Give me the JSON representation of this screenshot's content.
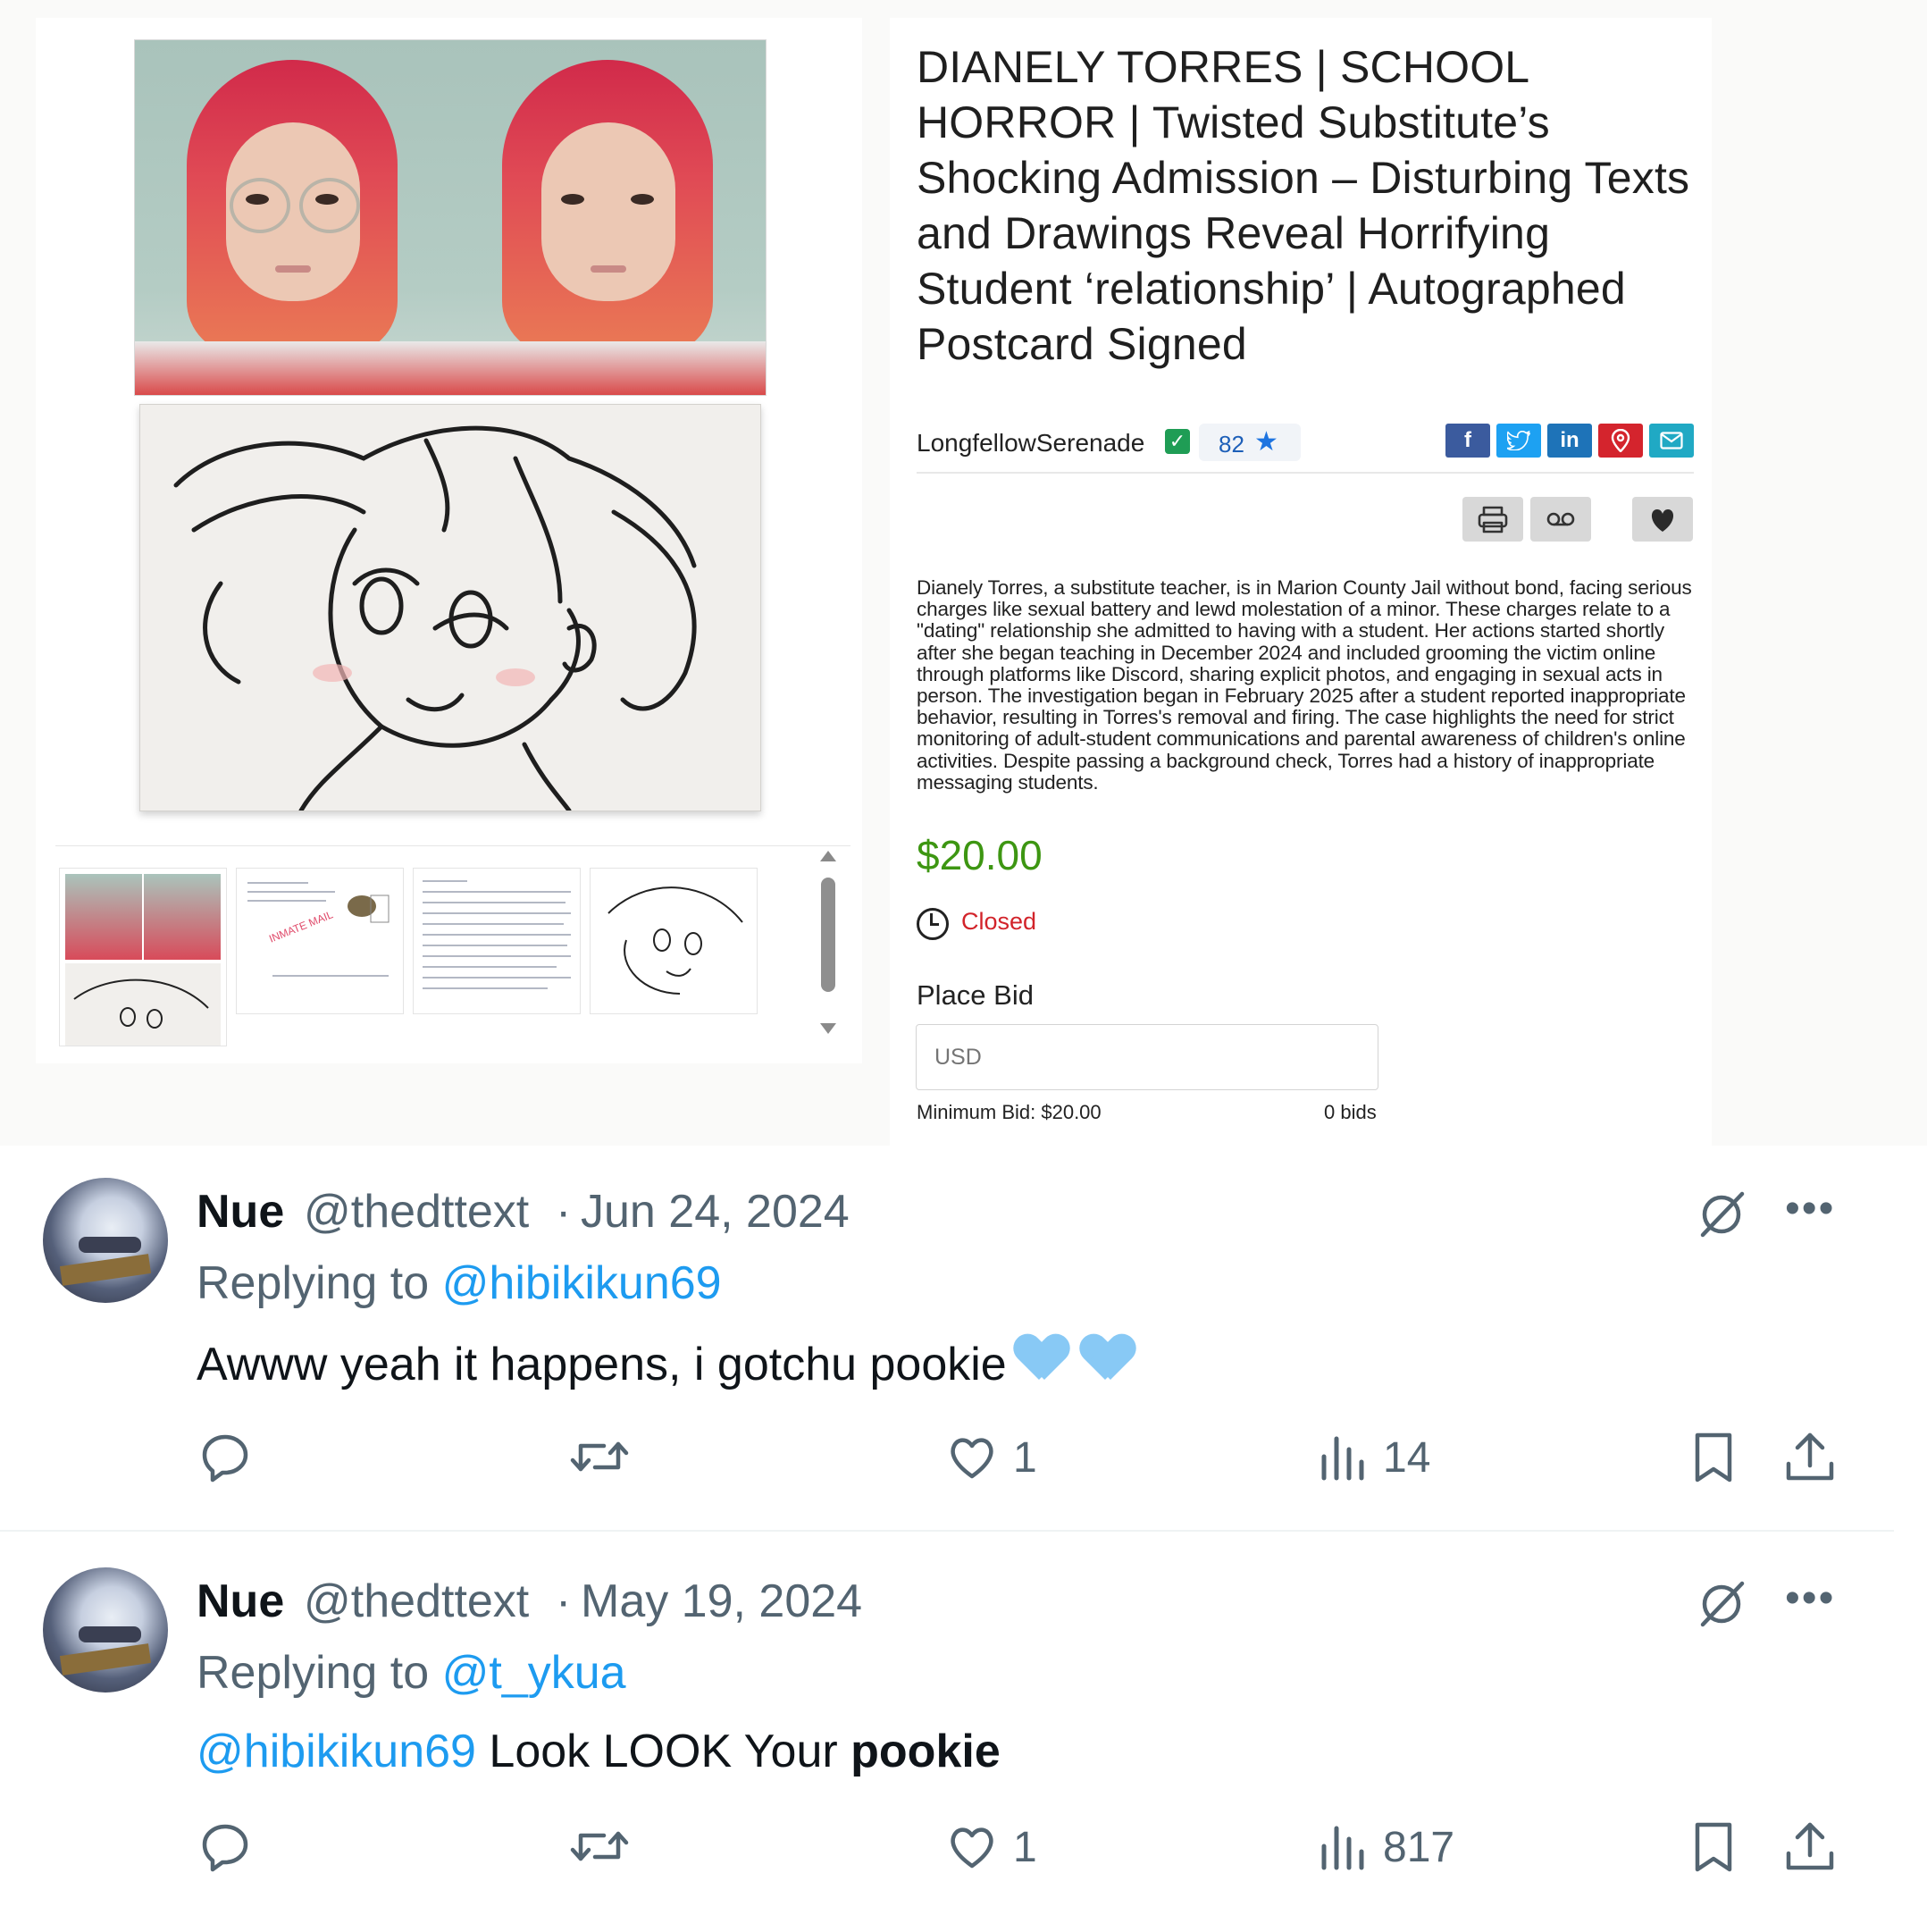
{
  "listing": {
    "title": "DIANELY TORRES | SCHOOL HORROR | Twisted Substitute’s Shocking Admission – Disturbing Texts and Drawings Reveal Horrifying Student ‘relationship’ | Autographed Postcard Signed",
    "seller": "LongfellowSerenade",
    "rating": "82",
    "description": "Dianely Torres, a substitute teacher, is in Marion County Jail without bond, facing serious charges like sexual battery and lewd molestation of a minor. These charges relate to a \"dating\" relationship she admitted to having with a student. Her actions started shortly after she began teaching in December 2024 and included grooming the victim online through platforms like Discord, sharing explicit photos, and engaging in sexual acts in person. The investigation began in February 2025 after a student reported inappropriate behavior, resulting in Torres's removal and firing. The case highlights the need for strict monitoring of adult-student communications and parental awareness of children's online activities. Despite passing a background check, Torres had a history of inappropriate messaging students.",
    "price": "$20.00",
    "status": "Closed",
    "place_bid_label": "Place Bid",
    "bid_placeholder": "USD",
    "min_bid": "Minimum Bid: $20.00",
    "bid_count": "0 bids",
    "thumbnail_stamp": "INMATE MAIL",
    "share_buttons": [
      "facebook-icon",
      "twitter-icon",
      "linkedin-icon",
      "pinterest-icon",
      "mail-icon"
    ],
    "colors": {
      "price": "#3d9612",
      "closed": "#d2232a",
      "facebook": "#3b5b9e",
      "twitter": "#1da1f2",
      "linkedin": "#1e73b8",
      "pinterest": "#d4242d",
      "mail": "#20a9c4"
    }
  },
  "tweets": [
    {
      "name": "Nue",
      "handle": "@thedttext",
      "separator": "·",
      "date": "Jun 24, 2024",
      "replying_prefix": "Replying to",
      "replying_to": "@hibikikun69",
      "text": "Awww yeah it happens, i gotchu pookie",
      "likes": "1",
      "views": "14"
    },
    {
      "name": "Nue",
      "handle": "@thedttext",
      "separator": "·",
      "date": "May 19, 2024",
      "replying_prefix": "Replying to",
      "replying_to": "@t_ykua",
      "text_mention": "@hibikikun69",
      "text_plain": "Look LOOK Your",
      "text_bold": "pookie",
      "likes": "1",
      "views": "817"
    }
  ]
}
